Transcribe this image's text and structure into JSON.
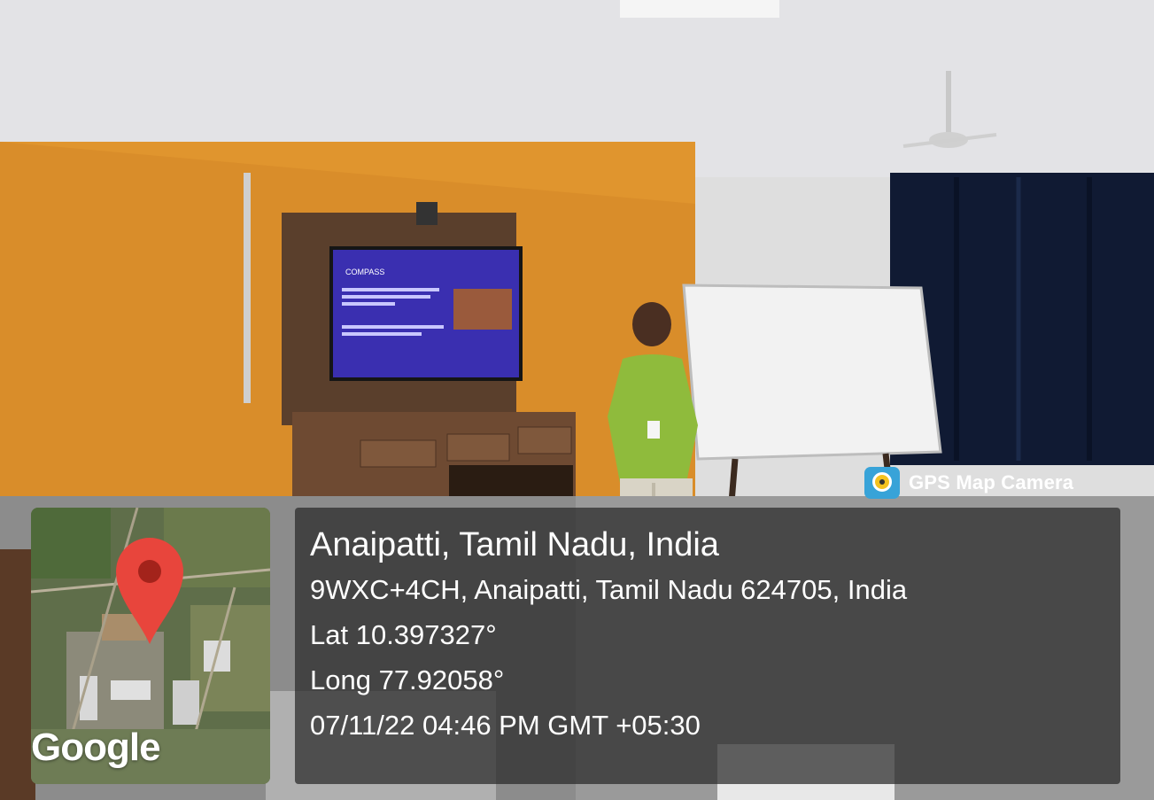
{
  "stamp": {
    "app_name": "GPS Map Camera",
    "app_icon": "camera-pin-icon"
  },
  "map": {
    "provider_label": "Google",
    "marker_icon": "location-pin-icon"
  },
  "location": {
    "place": "Anaipatti, Tamil Nadu, India",
    "address": "9WXC+4CH, Anaipatti, Tamil Nadu 624705, India",
    "lat": "Lat 10.397327°",
    "long": "Long 77.92058°",
    "datetime": "07/11/22 04:46 PM GMT +05:30"
  },
  "screen_slide": {
    "title": "COMPASS"
  }
}
